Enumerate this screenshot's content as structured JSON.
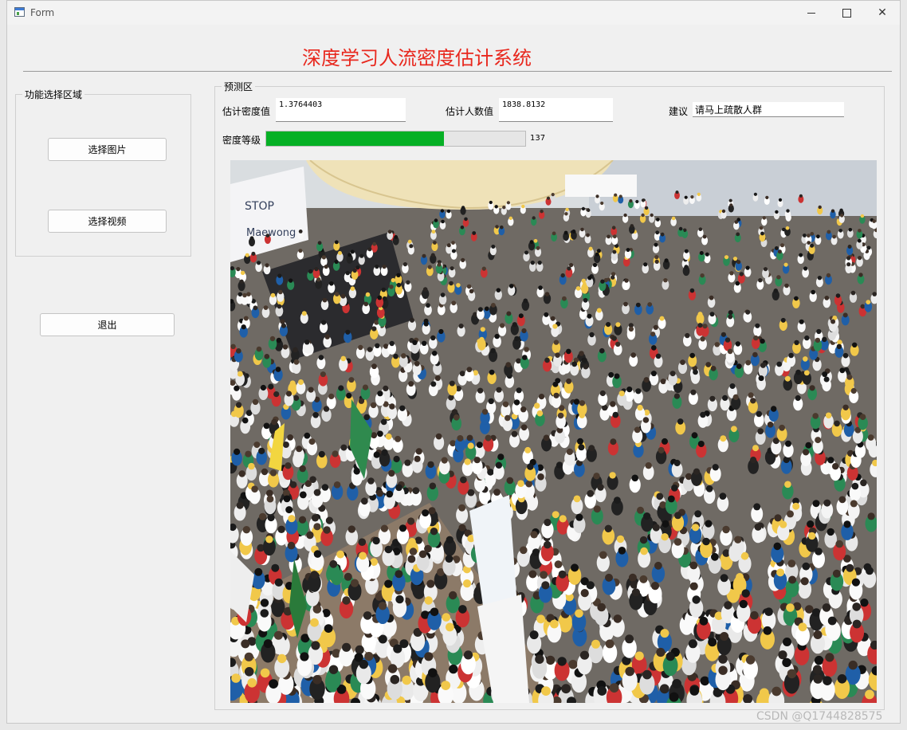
{
  "window": {
    "title": "Form",
    "icon": "form-app-icon",
    "controls": {
      "minimize": "minimize-icon",
      "maximize": "maximize-icon",
      "close": "close-icon"
    }
  },
  "header": {
    "title": "深度学习人流密度估计系统",
    "title_color": "#e8281e"
  },
  "function_area": {
    "label": "功能选择区域",
    "select_image_label": "选择图片",
    "select_video_label": "选择视频",
    "exit_label": "退出"
  },
  "prediction": {
    "label": "预测区",
    "density_label": "估计密度值",
    "density_value": "1.3764403",
    "count_label": "估计人数值",
    "count_value": "1838.8132",
    "advice_label": "建议",
    "advice_value": "请马上疏散人群",
    "level_label": "密度等级",
    "level_text": "137",
    "level_fraction": 0.685,
    "level_color": "#06b025",
    "image": "crowd-photo"
  },
  "watermark": "CSDN @Q1744828575"
}
